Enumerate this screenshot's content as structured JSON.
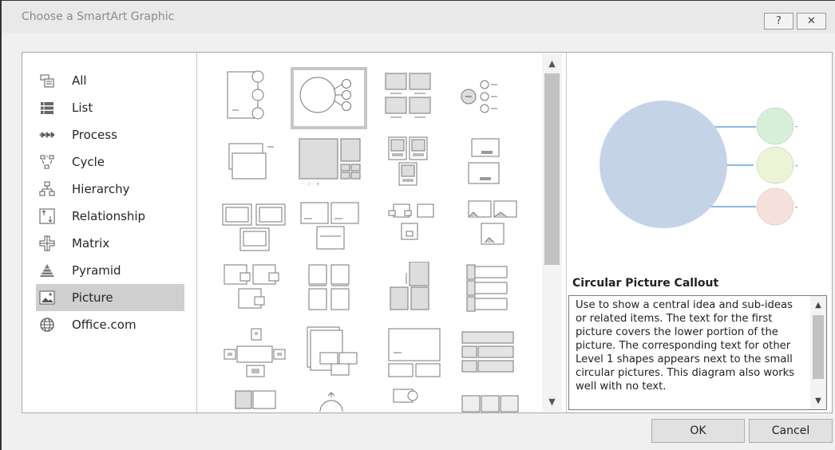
{
  "window": {
    "title": "Choose a SmartArt Graphic",
    "help_label": "?",
    "close_label": "✕"
  },
  "categories": [
    {
      "label": "All",
      "icon": "all-icon"
    },
    {
      "label": "List",
      "icon": "list-icon"
    },
    {
      "label": "Process",
      "icon": "process-icon"
    },
    {
      "label": "Cycle",
      "icon": "cycle-icon"
    },
    {
      "label": "Hierarchy",
      "icon": "hierarchy-icon"
    },
    {
      "label": "Relationship",
      "icon": "relationship-icon"
    },
    {
      "label": "Matrix",
      "icon": "matrix-icon"
    },
    {
      "label": "Pyramid",
      "icon": "pyramid-icon"
    },
    {
      "label": "Picture",
      "icon": "picture-icon",
      "selected": true
    },
    {
      "label": "Office.com",
      "icon": "globe-icon"
    }
  ],
  "gallery": {
    "selected_index": 1,
    "count": 24
  },
  "preview": {
    "title": "Circular Picture Callout",
    "description": "Use to show a central idea and sub-ideas or related items. The text for the first picture covers the lower portion of the picture. The corresponding text for other Level 1 shapes appears next to the small circular pictures. This diagram also works well with no text."
  },
  "colors": {
    "main_circle": "#c5d3e8",
    "sub1": "#d5efd9",
    "sub2": "#ebf4d5",
    "sub3": "#f5e2dc",
    "line": "#4a8fd0"
  },
  "buttons": {
    "ok": "OK",
    "cancel": "Cancel"
  }
}
